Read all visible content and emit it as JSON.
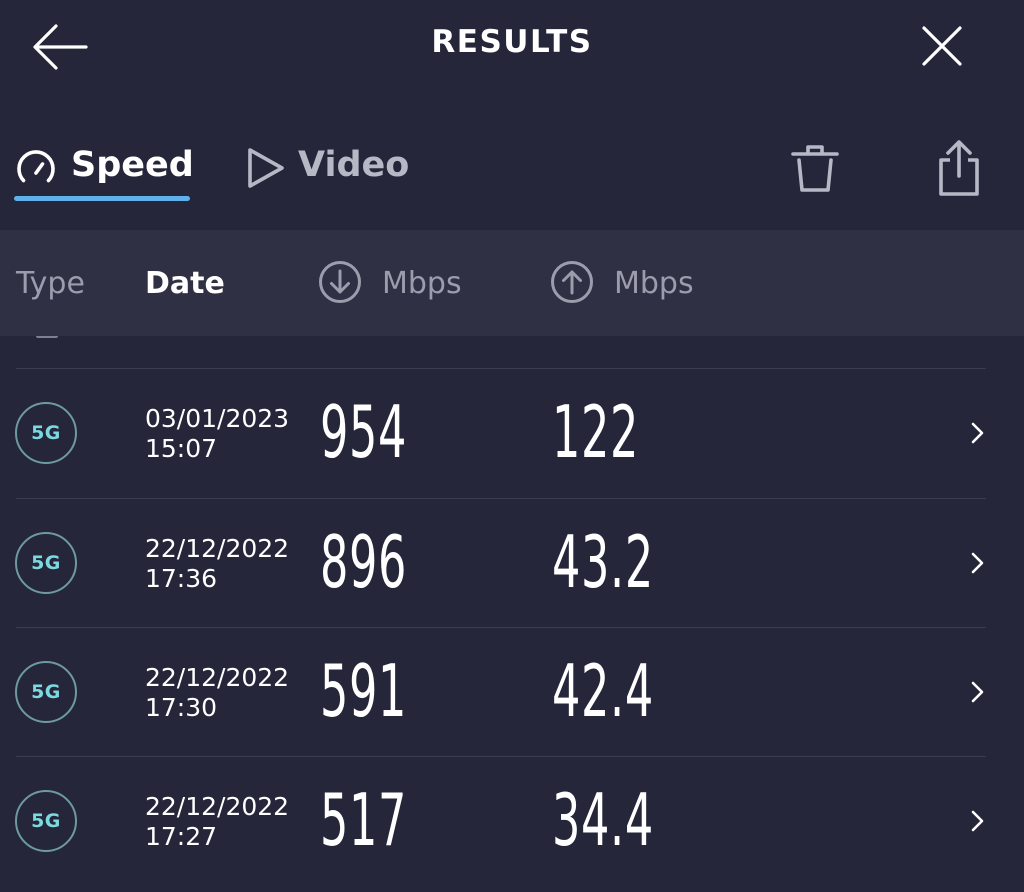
{
  "header": {
    "title": "RESULTS",
    "back_icon": "arrow-left-icon",
    "close_icon": "close-icon"
  },
  "tabs": [
    {
      "label": "Speed",
      "icon": "gauge-icon",
      "active": true
    },
    {
      "label": "Video",
      "icon": "play-icon",
      "active": false
    }
  ],
  "toolbar": {
    "delete_icon": "trash-icon",
    "share_icon": "share-icon"
  },
  "columns": {
    "type": "Type",
    "date": "Date",
    "download_unit": "Mbps",
    "upload_unit": "Mbps",
    "download_icon": "arrow-down-circle-icon",
    "upload_icon": "arrow-up-circle-icon"
  },
  "rows": [
    {
      "type": "5G",
      "date": "03/01/2023",
      "time": "15:07",
      "download": "954",
      "upload": "122"
    },
    {
      "type": "5G",
      "date": "22/12/2022",
      "time": "17:36",
      "download": "896",
      "upload": "43.2"
    },
    {
      "type": "5G",
      "date": "22/12/2022",
      "time": "17:30",
      "download": "591",
      "upload": "42.4"
    },
    {
      "type": "5G",
      "date": "22/12/2022",
      "time": "17:27",
      "download": "517",
      "upload": "34.4"
    }
  ],
  "colors": {
    "background": "#252639",
    "header_band": "#2f3043",
    "accent": "#5fb0ec",
    "badge_text": "#7cd9e0",
    "badge_border": "#6d9aa0",
    "muted_text": "#9c9dac"
  }
}
